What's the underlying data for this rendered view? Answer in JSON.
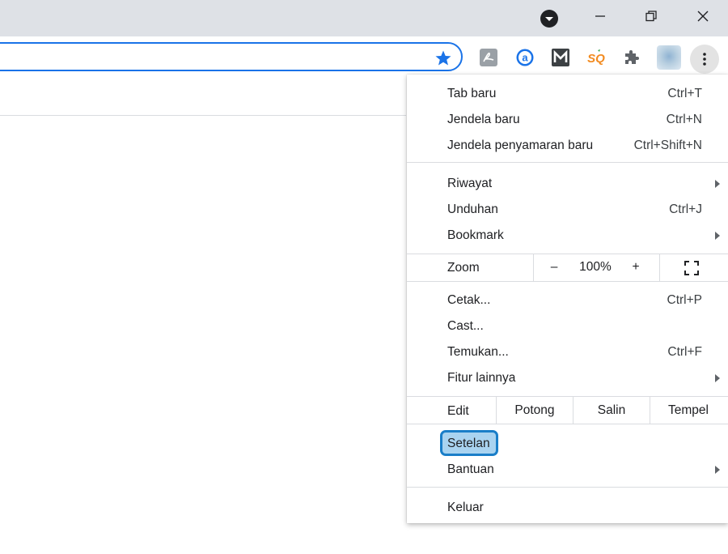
{
  "window": {
    "controls": {
      "minimize_icon": "minimize-icon",
      "maximize_icon": "restore-icon",
      "close_icon": "close-icon"
    }
  },
  "toolbar": {
    "bookmark_icon": "star-icon",
    "extensions": [
      "pdf-extension-icon",
      "at-extension-icon",
      "m-extension-icon",
      "sq-extension-icon",
      "puzzle-icon",
      "profile-avatar"
    ],
    "menu_icon": "kebab-menu-icon"
  },
  "menu": {
    "new_tab": {
      "label": "Tab baru",
      "shortcut": "Ctrl+T"
    },
    "new_window": {
      "label": "Jendela baru",
      "shortcut": "Ctrl+N"
    },
    "incognito": {
      "label": "Jendela penyamaran baru",
      "shortcut": "Ctrl+Shift+N"
    },
    "history": {
      "label": "Riwayat"
    },
    "downloads": {
      "label": "Unduhan",
      "shortcut": "Ctrl+J"
    },
    "bookmarks": {
      "label": "Bookmark"
    },
    "zoom": {
      "label": "Zoom",
      "minus": "–",
      "value": "100%",
      "plus": "+"
    },
    "print": {
      "label": "Cetak...",
      "shortcut": "Ctrl+P"
    },
    "cast": {
      "label": "Cast..."
    },
    "find": {
      "label": "Temukan...",
      "shortcut": "Ctrl+F"
    },
    "more_tools": {
      "label": "Fitur lainnya"
    },
    "edit": {
      "label": "Edit",
      "cut": "Potong",
      "copy": "Salin",
      "paste": "Tempel"
    },
    "settings": {
      "label": "Setelan"
    },
    "help": {
      "label": "Bantuan"
    },
    "exit": {
      "label": "Keluar"
    }
  },
  "colors": {
    "accent": "#1a73e8",
    "highlight_fill": "#a9d3f0",
    "highlight_border": "#1a7ec8",
    "titlebar": "#dee1e6"
  }
}
